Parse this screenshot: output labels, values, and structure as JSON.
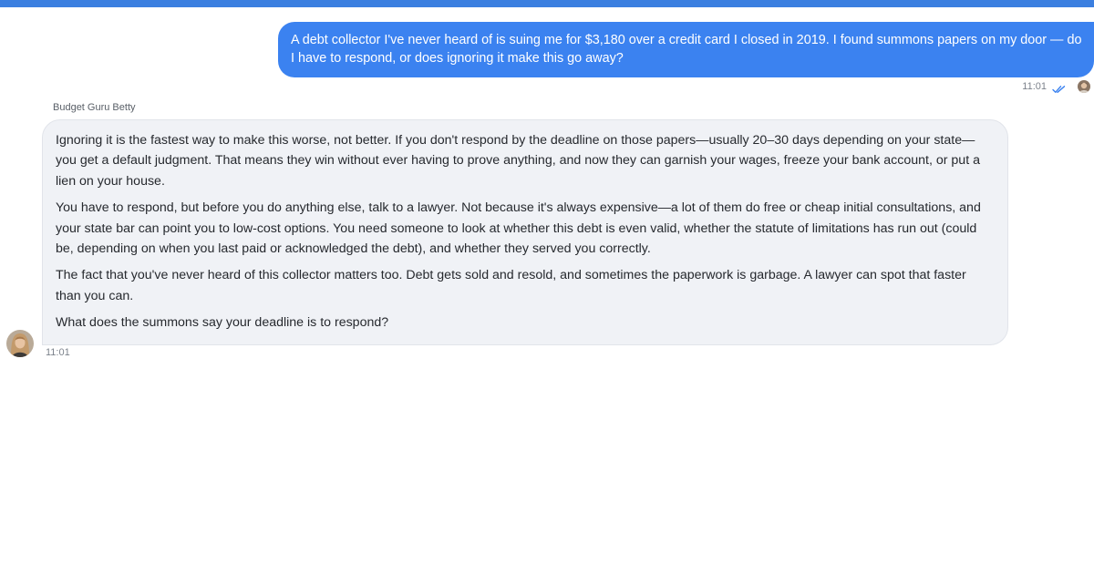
{
  "colors": {
    "accent": "#3b82f0",
    "top_bar": "#3b7fe0",
    "bot_bubble_bg": "#f0f2f6",
    "read_check": "#3b82f0"
  },
  "user_message": {
    "text": "A debt collector I've never heard of is suing me for $3,180 over a credit card I closed in 2019. I found summons papers on my door — do I have to respond, or does ignoring it make this go away?",
    "time": "11:01",
    "status_icon": "double-check-icon",
    "avatar_icon": "user-avatar"
  },
  "bot_message": {
    "sender": "Budget Guru Betty",
    "paragraphs": [
      "Ignoring it is the fastest way to make this worse, not better. If you don't respond by the deadline on those papers—usually 20–30 days depending on your state—you get a default judgment. That means they win without ever having to prove anything, and now they can garnish your wages, freeze your bank account, or put a lien on your house.",
      "You have to respond, but before you do anything else, talk to a lawyer. Not because it's always expensive—a lot of them do free or cheap initial consultations, and your state bar can point you to low-cost options. You need someone to look at whether this debt is even valid, whether the statute of limitations has run out (could be, depending on when you last paid or acknowledged the debt), and whether they served you correctly.",
      "The fact that you've never heard of this collector matters too. Debt gets sold and resold, and sometimes the paperwork is garbage. A lawyer can spot that faster than you can.",
      "What does the summons say your deadline is to respond?"
    ],
    "time": "11:01",
    "avatar_icon": "assistant-avatar"
  }
}
